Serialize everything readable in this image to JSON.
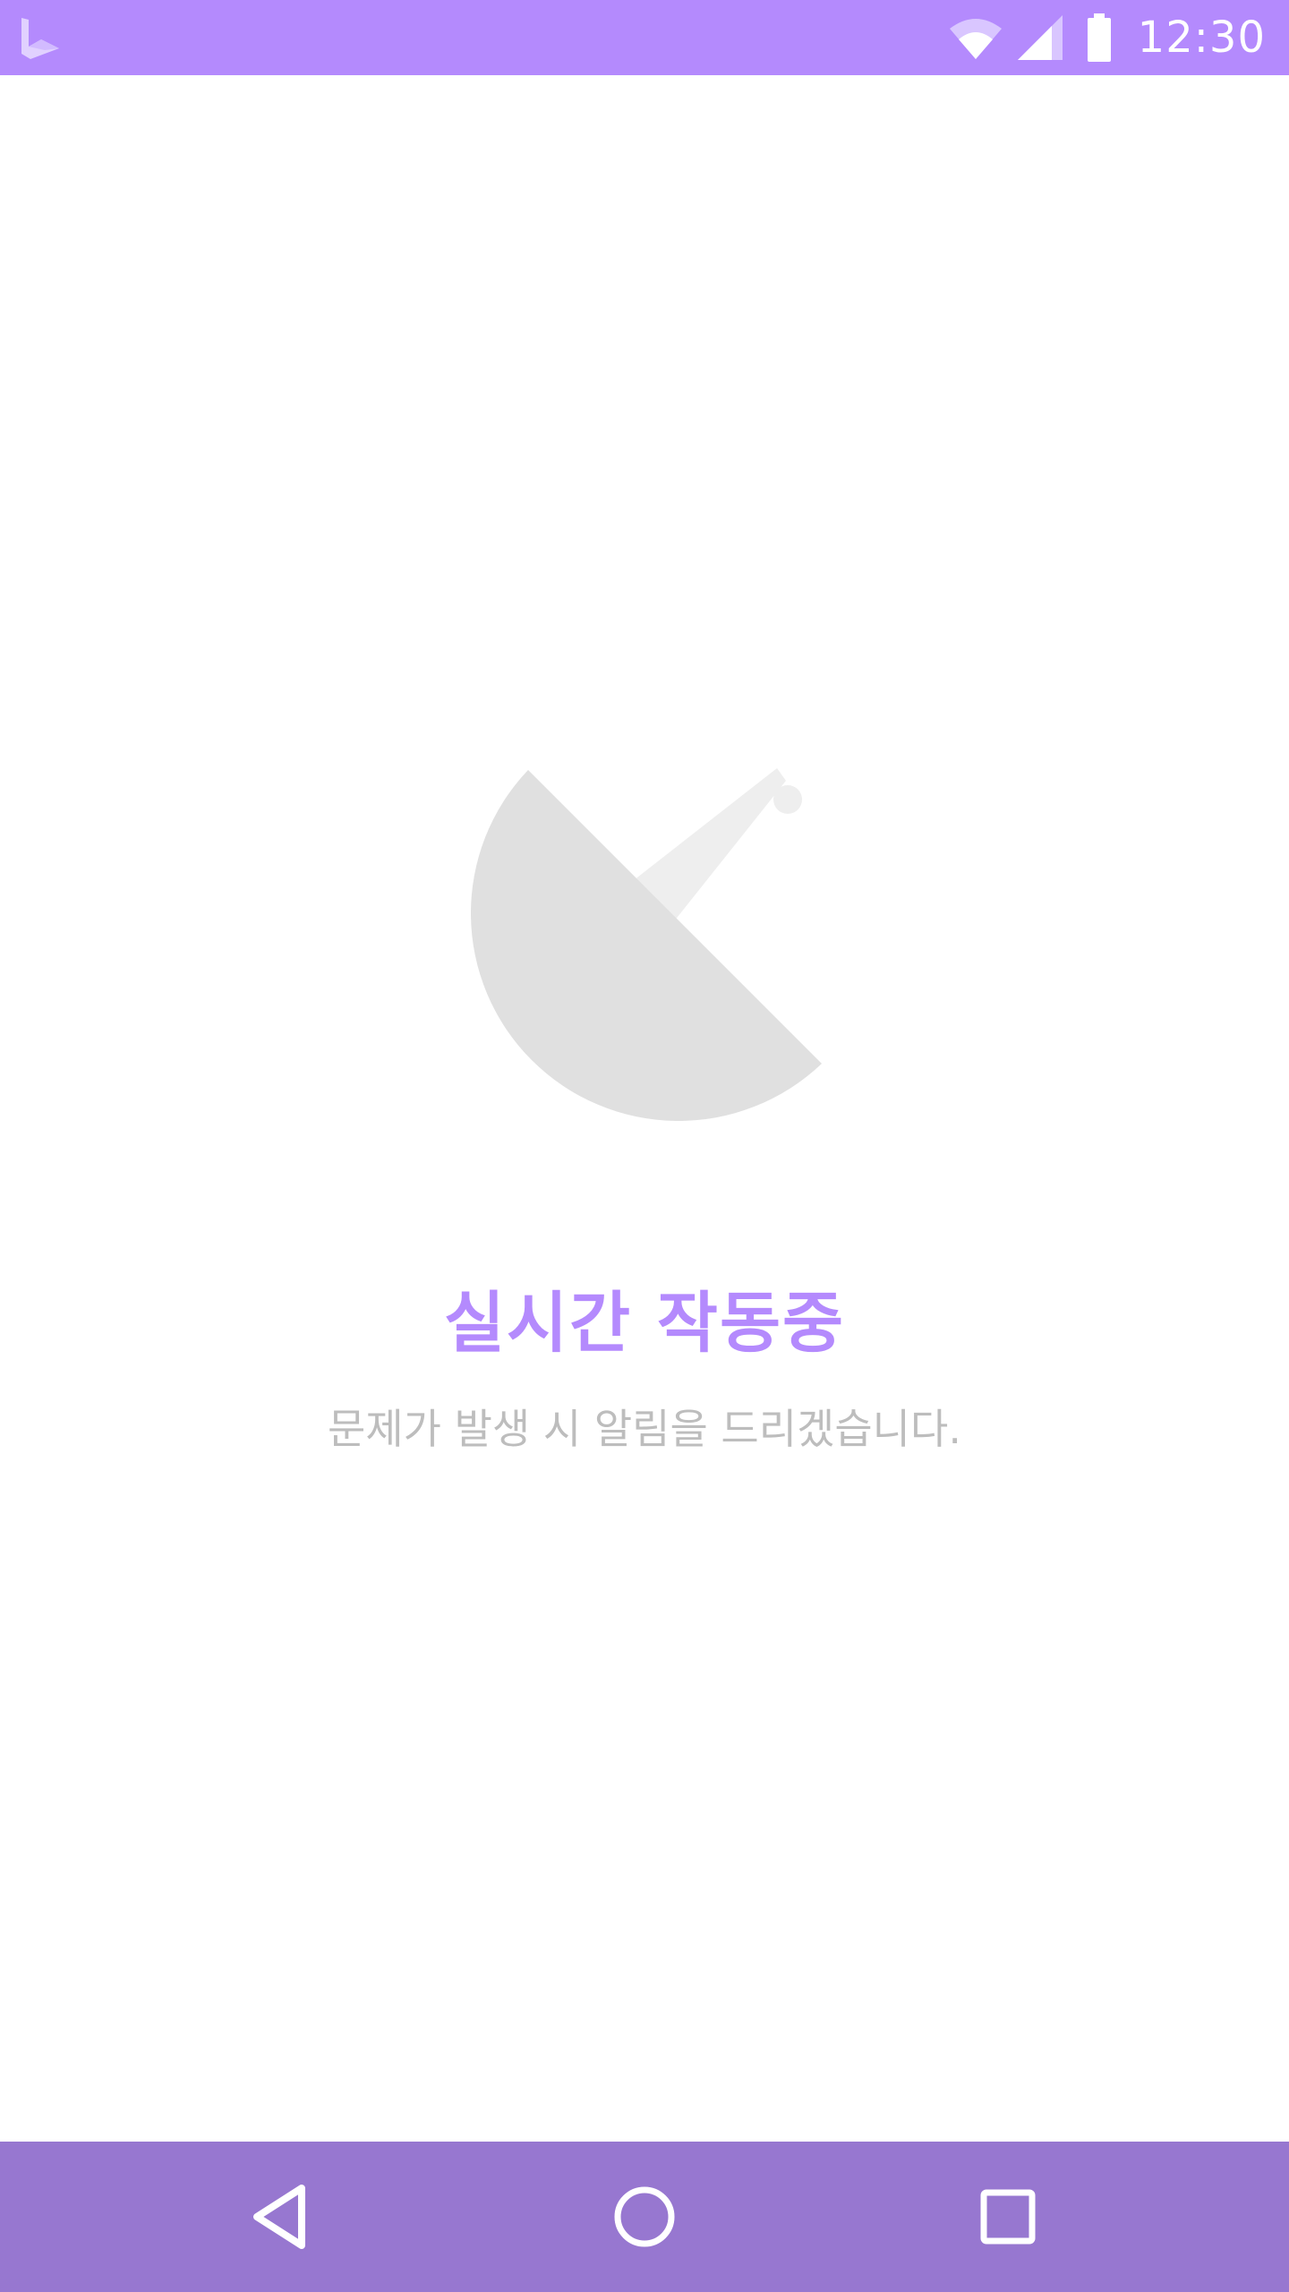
{
  "status_bar": {
    "time": "12:30",
    "background_color": "#b48afd",
    "icons": [
      "app-logo-icon",
      "wifi-icon",
      "signal-icon",
      "battery-icon"
    ]
  },
  "main": {
    "illustration_icon": "satellite-dish-icon",
    "title": "실시간 작동중",
    "message": "문제가 발생 시 알림을 드리겠습니다.",
    "accent_color": "#b48afd",
    "message_color": "#bdbdbd"
  },
  "nav_bar": {
    "background_color": "#9777d0",
    "buttons": [
      "back-icon",
      "home-icon",
      "recents-icon"
    ]
  }
}
